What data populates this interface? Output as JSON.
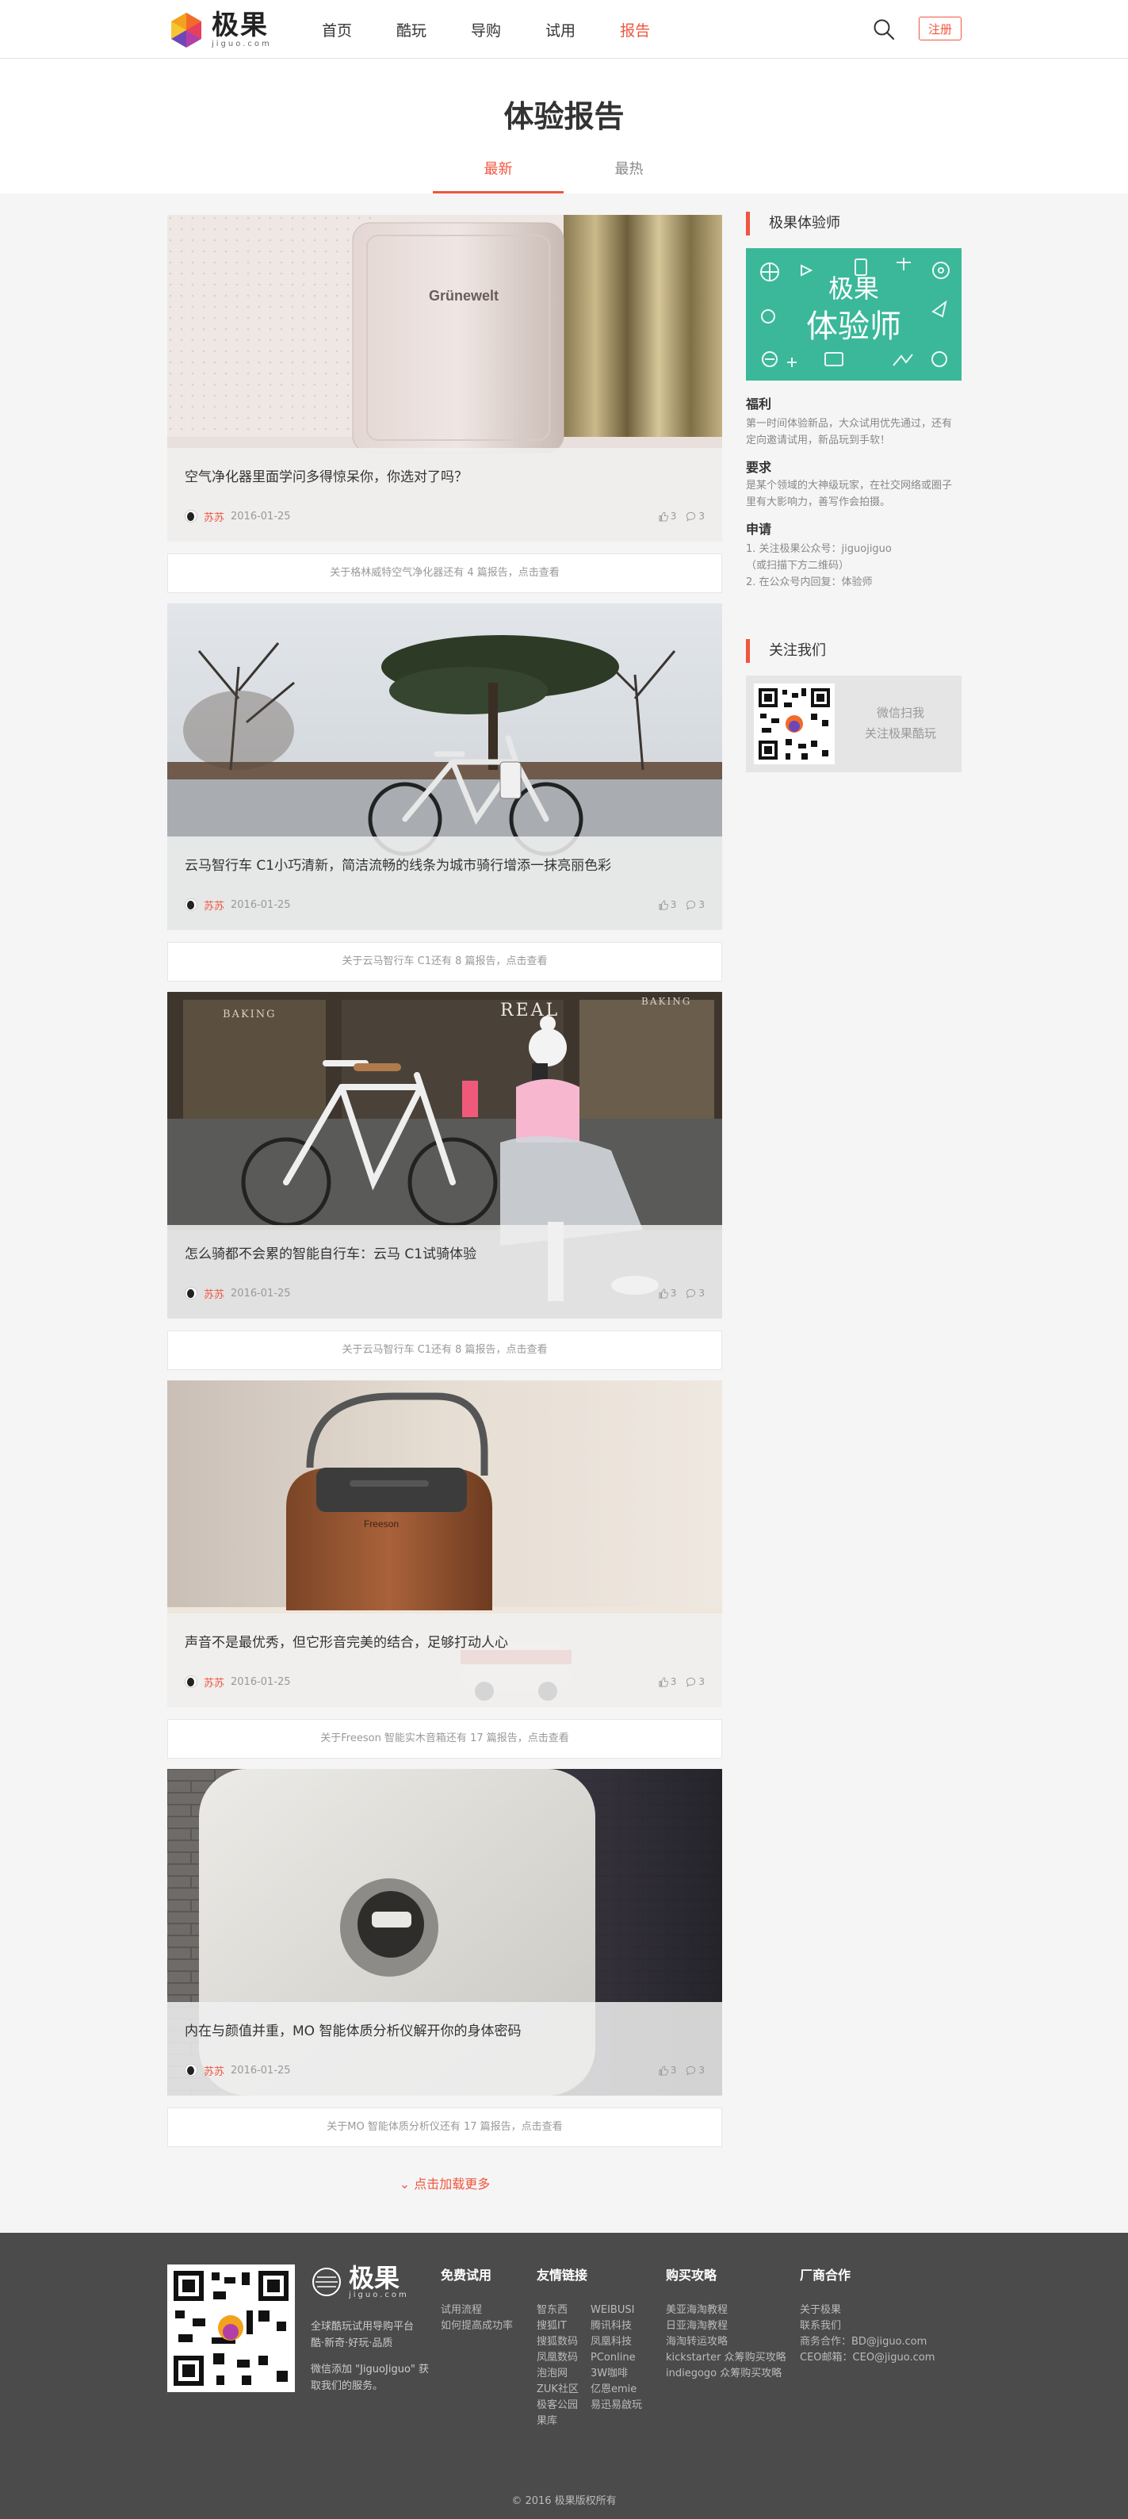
{
  "header": {
    "logo_cn": "极果",
    "logo_en": "jiguo.com",
    "nav": [
      "首页",
      "酷玩",
      "导购",
      "试用",
      "报告"
    ],
    "active_nav": "报告",
    "register_label": "注册"
  },
  "page": {
    "title": "体验报告",
    "tabs": [
      "最新",
      "最热"
    ]
  },
  "reports": [
    {
      "title": "空气净化器里面学问多得惊呆你，你选对了吗？",
      "author": "苏苏",
      "date": "2016-01-25",
      "likes": "3",
      "comments": "3",
      "brand_text": "Grünewelt",
      "more_label": "关于格林威特空气净化器还有 4 篇报告，点击查看"
    },
    {
      "title": "云马智行车 C1小巧清新，简洁流畅的线条为城市骑行增添一抹亮丽色彩",
      "author": "苏苏",
      "date": "2016-01-25",
      "likes": "3",
      "comments": "3",
      "more_label": "关于云马智行车 C1还有 8 篇报告，点击查看"
    },
    {
      "title": "怎么骑都不会累的智能自行车：云马 C1试骑体验",
      "author": "苏苏",
      "date": "2016-01-25",
      "likes": "3",
      "comments": "3",
      "shop_sign_left": "BAKING",
      "shop_sign_center": "REAL",
      "shop_sign_right": "BAKING",
      "more_label": "关于云马智行车 C1还有 8 篇报告，点击查看"
    },
    {
      "title": "声音不是最优秀，但它形音完美的结合，足够打动人心",
      "author": "苏苏",
      "date": "2016-01-25",
      "likes": "3",
      "comments": "3",
      "brand_text": "Freeson",
      "more_label": "关于Freeson 智能实木音箱还有 17 篇报告，点击查看"
    },
    {
      "title": "内在与颜值并重，MO 智能体质分析仪解开你的身体密码",
      "author": "苏苏",
      "date": "2016-01-25",
      "likes": "3",
      "comments": "3",
      "more_label": "关于MO 智能体质分析仪还有 17 篇报告，点击查看"
    }
  ],
  "load_more": "点击加载更多",
  "sidebar": {
    "tester_heading": "极果体验师",
    "banner_line1": "极果",
    "banner_line2": "体验师",
    "benefit_title": "福利",
    "benefit_text": "第一时间体验新品，大众试用优先通过，还有定向邀请试用，新品玩到手软！",
    "req_title": "要求",
    "req_text": "是某个领域的大神级玩家，在社交网络或圈子里有大影响力，善写作会拍摄。",
    "apply_title": "申请",
    "apply_lines": [
      "1. 关注极果公众号：jiguojiguo",
      "（或扫描下方二维码）",
      "2. 在公众号内回复：体验师"
    ],
    "follow_heading": "关注我们",
    "follow_line1": "微信扫我",
    "follow_line2": "关注极果酷玩"
  },
  "footer": {
    "logo_cn": "极果",
    "logo_en": "jiguo.com",
    "slogan": "全球酷玩试用导购平台 酷·新奇·好玩·品质",
    "wechat": "微信添加 \"JiguoJiguo\" 获取我们的服务。",
    "col1_title": "免费试用",
    "col1_links": [
      "试用流程",
      "如何提高成功率"
    ],
    "col2_title": "友情链接",
    "col2_links_a": [
      "智东西",
      "搜狐IT",
      "搜狐数码",
      "凤凰数码",
      "泡泡网",
      "ZUK社区",
      "极客公园",
      "果库"
    ],
    "col2_links_b": [
      "WEIBUSI",
      "腾讯科技",
      "凤凰科技",
      "PConline",
      "3W咖啡",
      "亿恩emie",
      "易迅易啟玩"
    ],
    "col3_title": "购买攻略",
    "col3_links": [
      "美亚海淘教程",
      "日亚海淘教程",
      "海淘转运攻略",
      "kickstarter 众筹购买攻略",
      "indiegogo 众筹购买攻略"
    ],
    "col4_title": "厂商合作",
    "col4_links": [
      "关于极果",
      "联系我们",
      "商务合作：BD@jiguo.com",
      "CEO邮箱：CEO@jiguo.com"
    ],
    "copyright": "© 2016 极果版权所有"
  },
  "colors": {
    "accent": "#f0553f",
    "footer_bg": "#4b4b4b",
    "tester_green": "#3bb89a"
  }
}
